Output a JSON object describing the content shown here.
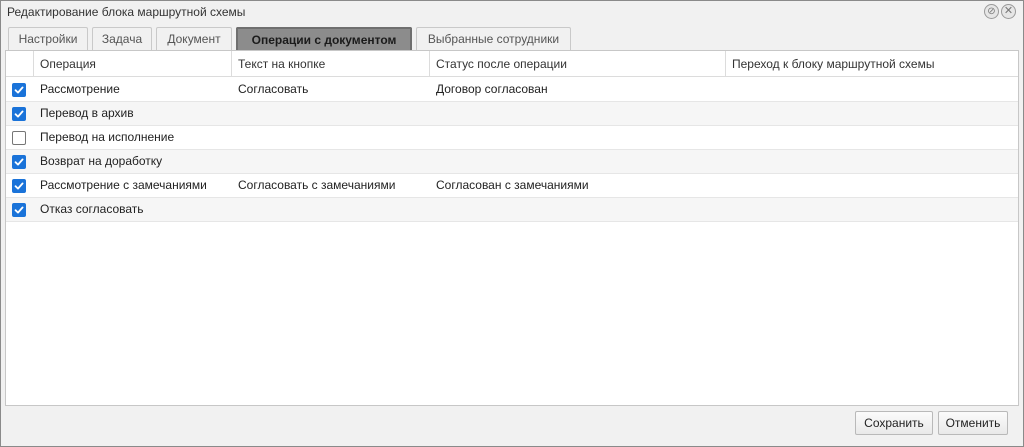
{
  "window": {
    "title": "Редактирование блока маршрутной схемы",
    "restore_icon": "restore-icon",
    "close_icon": "close-icon"
  },
  "tabs": [
    {
      "label": "Настройки",
      "active": false
    },
    {
      "label": "Задача",
      "active": false
    },
    {
      "label": "Документ",
      "active": false
    },
    {
      "label": "Операции с документом",
      "active": true
    },
    {
      "label": "Выбранные сотрудники",
      "active": false
    }
  ],
  "grid": {
    "columns": [
      "Операция",
      "Текст на кнопке",
      "Статус после операции",
      "Переход к блоку маршрутной схемы"
    ],
    "rows": [
      {
        "checked": true,
        "operation": "Рассмотрение",
        "button_text": "Согласовать",
        "status": "Договор согласован",
        "transition": ""
      },
      {
        "checked": true,
        "operation": "Перевод в архив",
        "button_text": "",
        "status": "",
        "transition": ""
      },
      {
        "checked": false,
        "operation": "Перевод на исполнение",
        "button_text": "",
        "status": "",
        "transition": ""
      },
      {
        "checked": true,
        "operation": "Возврат на доработку",
        "button_text": "",
        "status": "",
        "transition": ""
      },
      {
        "checked": true,
        "operation": "Рассмотрение с замечаниями",
        "button_text": "Согласовать с замечаниями",
        "status": "Согласован с замечаниями",
        "transition": ""
      },
      {
        "checked": true,
        "operation": "Отказ согласовать",
        "button_text": "",
        "status": "",
        "transition": ""
      }
    ]
  },
  "footer": {
    "save_label": "Сохранить",
    "cancel_label": "Отменить"
  },
  "colors": {
    "checkbox_checked": "#1a73d9",
    "active_tab": "#8c8c8c"
  }
}
